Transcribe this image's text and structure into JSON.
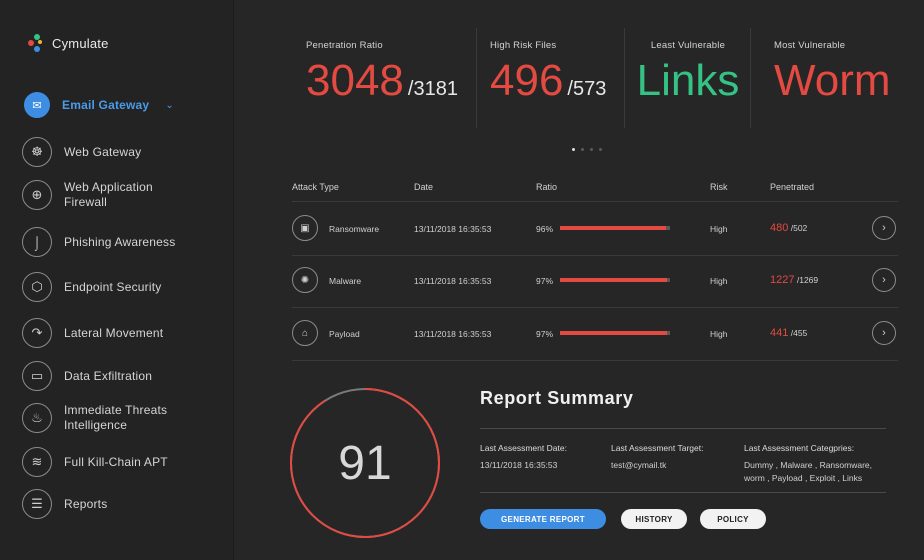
{
  "brand": {
    "name": "Cymulate",
    "dots": [
      "#e24a42",
      "#35c385",
      "#3d8ee3",
      "#f0b33a"
    ]
  },
  "sidebar": {
    "items": [
      {
        "label": "Email Gateway",
        "icon": "envelope-icon",
        "glyph": "✉",
        "active": true
      },
      {
        "label": "Web Gateway",
        "icon": "globe-gateway-icon",
        "glyph": "☸"
      },
      {
        "label": "Web Application Firewall",
        "icon": "globe-icon",
        "glyph": "⊕"
      },
      {
        "label": "Phishing Awareness",
        "icon": "hook-icon",
        "glyph": "⌡"
      },
      {
        "label": "Endpoint Security",
        "icon": "hexagon-icon",
        "glyph": "⬡"
      },
      {
        "label": "Lateral Movement",
        "icon": "arc-arrow-icon",
        "glyph": "↷"
      },
      {
        "label": "Data Exfiltration",
        "icon": "folder-icon",
        "glyph": "▭"
      },
      {
        "label": "Immediate Threats Intelligence",
        "icon": "flame-icon",
        "glyph": "♨"
      },
      {
        "label": "Full Kill-Chain APT",
        "icon": "chain-icon",
        "glyph": "≋"
      },
      {
        "label": "Reports",
        "icon": "report-icon",
        "glyph": "☰"
      }
    ]
  },
  "stats": [
    {
      "label": "Penetration Ratio",
      "value": "3048",
      "total": "/3181",
      "color": "#e24a42"
    },
    {
      "label": "High Risk Files",
      "value": "496",
      "total": "/573",
      "color": "#e24a42"
    },
    {
      "label": "Least Vulnerable",
      "value": "Links",
      "total": "",
      "color": "#35c385"
    },
    {
      "label": "Most Vulnerable",
      "value": "Worm",
      "total": "",
      "color": "#e24a42"
    }
  ],
  "carousel": {
    "pages": 4,
    "active": 0
  },
  "table": {
    "headers": [
      "Attack Type",
      "Date",
      "Ratio",
      "Risk",
      "Penetrated"
    ],
    "rows": [
      {
        "type": "Ransomware",
        "icon": "ransomware-icon",
        "glyph": "▣",
        "date": "13/11/2018 16:35:53",
        "ratio": "96%",
        "ratio_value": 0.96,
        "risk": "High",
        "pen": "480",
        "total": "/502"
      },
      {
        "type": "Malware",
        "icon": "bug-icon",
        "glyph": "✺",
        "date": "13/11/2018 16:35:53",
        "ratio": "97%",
        "ratio_value": 0.97,
        "risk": "High",
        "pen": "1227",
        "total": "/1269"
      },
      {
        "type": "Payload",
        "icon": "lock-icon",
        "glyph": "⌂",
        "date": "13/11/2018 16:35:53",
        "ratio": "97%",
        "ratio_value": 0.97,
        "risk": "High",
        "pen": "441",
        "total": "/455"
      }
    ]
  },
  "score": {
    "value": "91",
    "fraction": 0.91,
    "color": "#e24a42",
    "track": "#7a7a7a"
  },
  "summary": {
    "title": "Report Summary",
    "date_label": "Last Assessment Date:",
    "date_value": "13/11/2018 16:35:53",
    "target_label": "Last Assessment Target:",
    "target_value": "test@cymail.tk",
    "categories_label": "Last Assessment Categpries:",
    "categories_value": "Dummy , Malware , Ransomware, worm , Payload , Exploit , Links"
  },
  "buttons": {
    "generate": "GENERATE REPORT",
    "history": "HISTORY",
    "policy": "POLICY"
  }
}
